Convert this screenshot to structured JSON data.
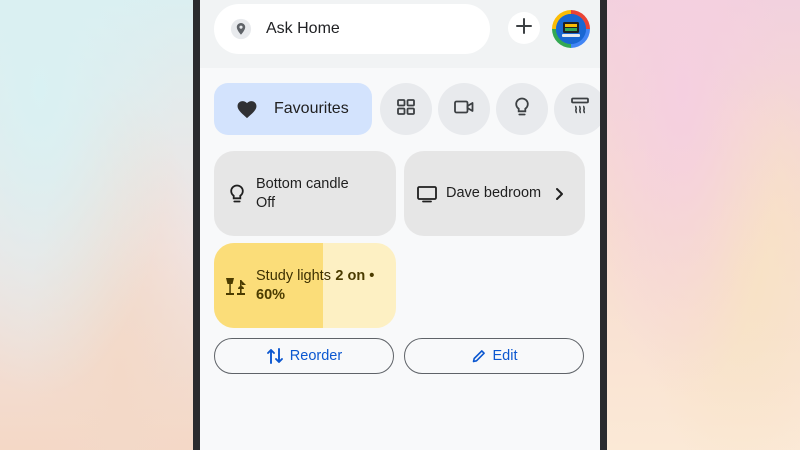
{
  "search": {
    "placeholder_text": "Ask Home",
    "icon": "location-pin-icon"
  },
  "header": {
    "add_icon": "plus-icon",
    "avatar_icon": "avatar"
  },
  "chips": {
    "favourites_label": "Favourites",
    "others": [
      "grid-icon",
      "camera-icon",
      "lightbulb-icon",
      "heater-icon"
    ]
  },
  "tiles": {
    "bottom_candle": {
      "name": "Bottom candle",
      "status": "Off"
    },
    "dave_bedroom": {
      "name": "Dave bedroom"
    },
    "study_lights": {
      "name": "Study lights",
      "status": "2 on • 60%",
      "brightness": 60
    }
  },
  "actions": {
    "reorder_label": "Reorder",
    "edit_label": "Edit"
  },
  "colors": {
    "accent": "#0b57d0",
    "favourite_chip": "#d3e3fd",
    "study_fill": "#fbdd79",
    "study_bg": "#fdf0c3"
  }
}
